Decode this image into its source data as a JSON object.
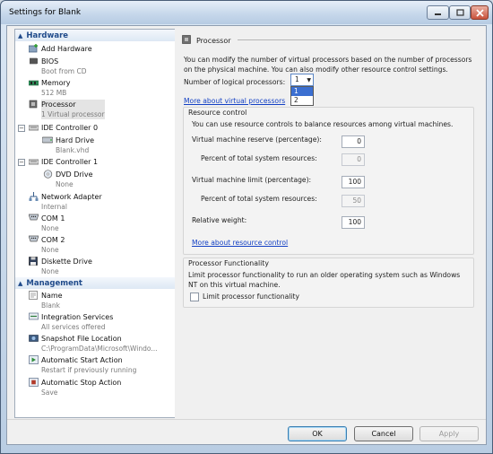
{
  "window": {
    "title": "Settings for Blank"
  },
  "tree": {
    "sections": {
      "hardware": "Hardware",
      "management": "Management"
    },
    "hardware_items": [
      {
        "label": "Add Hardware",
        "sub": ""
      },
      {
        "label": "BIOS",
        "sub": "Boot from CD"
      },
      {
        "label": "Memory",
        "sub": "512 MB"
      },
      {
        "label": "Processor",
        "sub": "1 Virtual processor"
      },
      {
        "label": "IDE Controller 0",
        "sub": ""
      },
      {
        "label": "Hard Drive",
        "sub": "Blank.vhd"
      },
      {
        "label": "IDE Controller 1",
        "sub": ""
      },
      {
        "label": "DVD Drive",
        "sub": "None"
      },
      {
        "label": "Network Adapter",
        "sub": "Internal"
      },
      {
        "label": "COM 1",
        "sub": "None"
      },
      {
        "label": "COM 2",
        "sub": "None"
      },
      {
        "label": "Diskette Drive",
        "sub": "None"
      }
    ],
    "management_items": [
      {
        "label": "Name",
        "sub": "Blank"
      },
      {
        "label": "Integration Services",
        "sub": "All services offered"
      },
      {
        "label": "Snapshot File Location",
        "sub": "C:\\ProgramData\\Microsoft\\Windo..."
      },
      {
        "label": "Automatic Start Action",
        "sub": "Restart if previously running"
      },
      {
        "label": "Automatic Stop Action",
        "sub": "Save"
      }
    ]
  },
  "panel": {
    "title": "Processor",
    "description": "You can modify the number of virtual processors based on the number of processors on the physical machine. You can also modify other resource control settings.",
    "num_processors_label": "Number of logical processors:",
    "num_processors_value": "1",
    "num_processors_options": [
      "1",
      "2"
    ],
    "more_virtual_link": "More about virtual processors",
    "resource_control": {
      "title": "Resource control",
      "description": "You can use resource controls to balance resources among virtual machines.",
      "reserve_label": "Virtual machine reserve (percentage):",
      "reserve_value": "0",
      "reserve_pct_label": "Percent of total system resources:",
      "reserve_pct_value": "0",
      "limit_label": "Virtual machine limit (percentage):",
      "limit_value": "100",
      "limit_pct_label": "Percent of total system resources:",
      "limit_pct_value": "50",
      "weight_label": "Relative weight:",
      "weight_value": "100",
      "more_link": "More about resource control"
    },
    "functionality": {
      "title": "Processor Functionality",
      "description": "Limit processor functionality to run an older operating system such as Windows NT on this virtual machine.",
      "checkbox_label": "Limit processor functionality"
    }
  },
  "buttons": {
    "ok": "OK",
    "cancel": "Cancel",
    "apply": "Apply"
  }
}
